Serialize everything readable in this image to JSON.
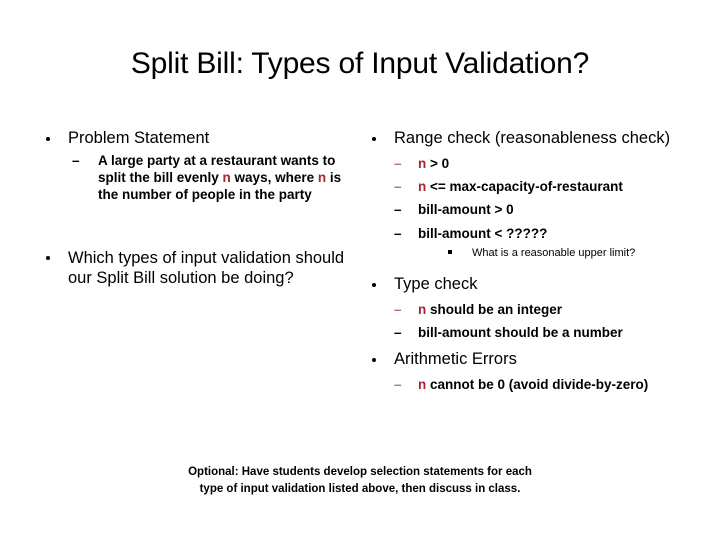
{
  "slide": {
    "title": "Split Bill: Types of Input Validation?",
    "accent_color": "#A32638",
    "dash_accent_color": "#C4686F",
    "text_color": "#000000",
    "background_color": "#FFFFFF"
  },
  "left_column": {
    "problem_statement": {
      "heading": "Problem Statement",
      "detail_part1": "A large party at a restaurant wants to split the bill evenly ",
      "detail_var1": "n",
      "detail_part2": " ways, where ",
      "detail_var2": "n",
      "detail_part3": " is the number of people in the party"
    },
    "question": "Which types of input validation should our Split Bill solution be doing?"
  },
  "right_column": {
    "range_check": {
      "heading": "Range check (reasonableness check)",
      "items": [
        {
          "var": "n",
          "text": " > 0",
          "dash_color": "red"
        },
        {
          "var": "n",
          "text": " <= max-capacity-of-restaurant",
          "dash_color": "red"
        },
        {
          "var": "",
          "text": "bill-amount > 0",
          "dash_color": "black"
        },
        {
          "var": "",
          "text": "bill-amount < ?????",
          "dash_color": "black"
        }
      ],
      "sub_note": "What is a reasonable upper limit?"
    },
    "type_check": {
      "heading": "Type check",
      "items": [
        {
          "var": "n",
          "text": " should be an integer",
          "dash_color": "red"
        },
        {
          "var": "",
          "text": "bill-amount should be a number",
          "dash_color": "black"
        }
      ]
    },
    "arithmetic_errors": {
      "heading": "Arithmetic Errors",
      "items": [
        {
          "var": "n",
          "text": " cannot be 0 (avoid divide-by-zero)",
          "dash_color": "red"
        }
      ]
    }
  },
  "footer": {
    "line1": "Optional: Have students develop selection statements for each",
    "line2": "type of input validation listed above, then discuss in class."
  }
}
